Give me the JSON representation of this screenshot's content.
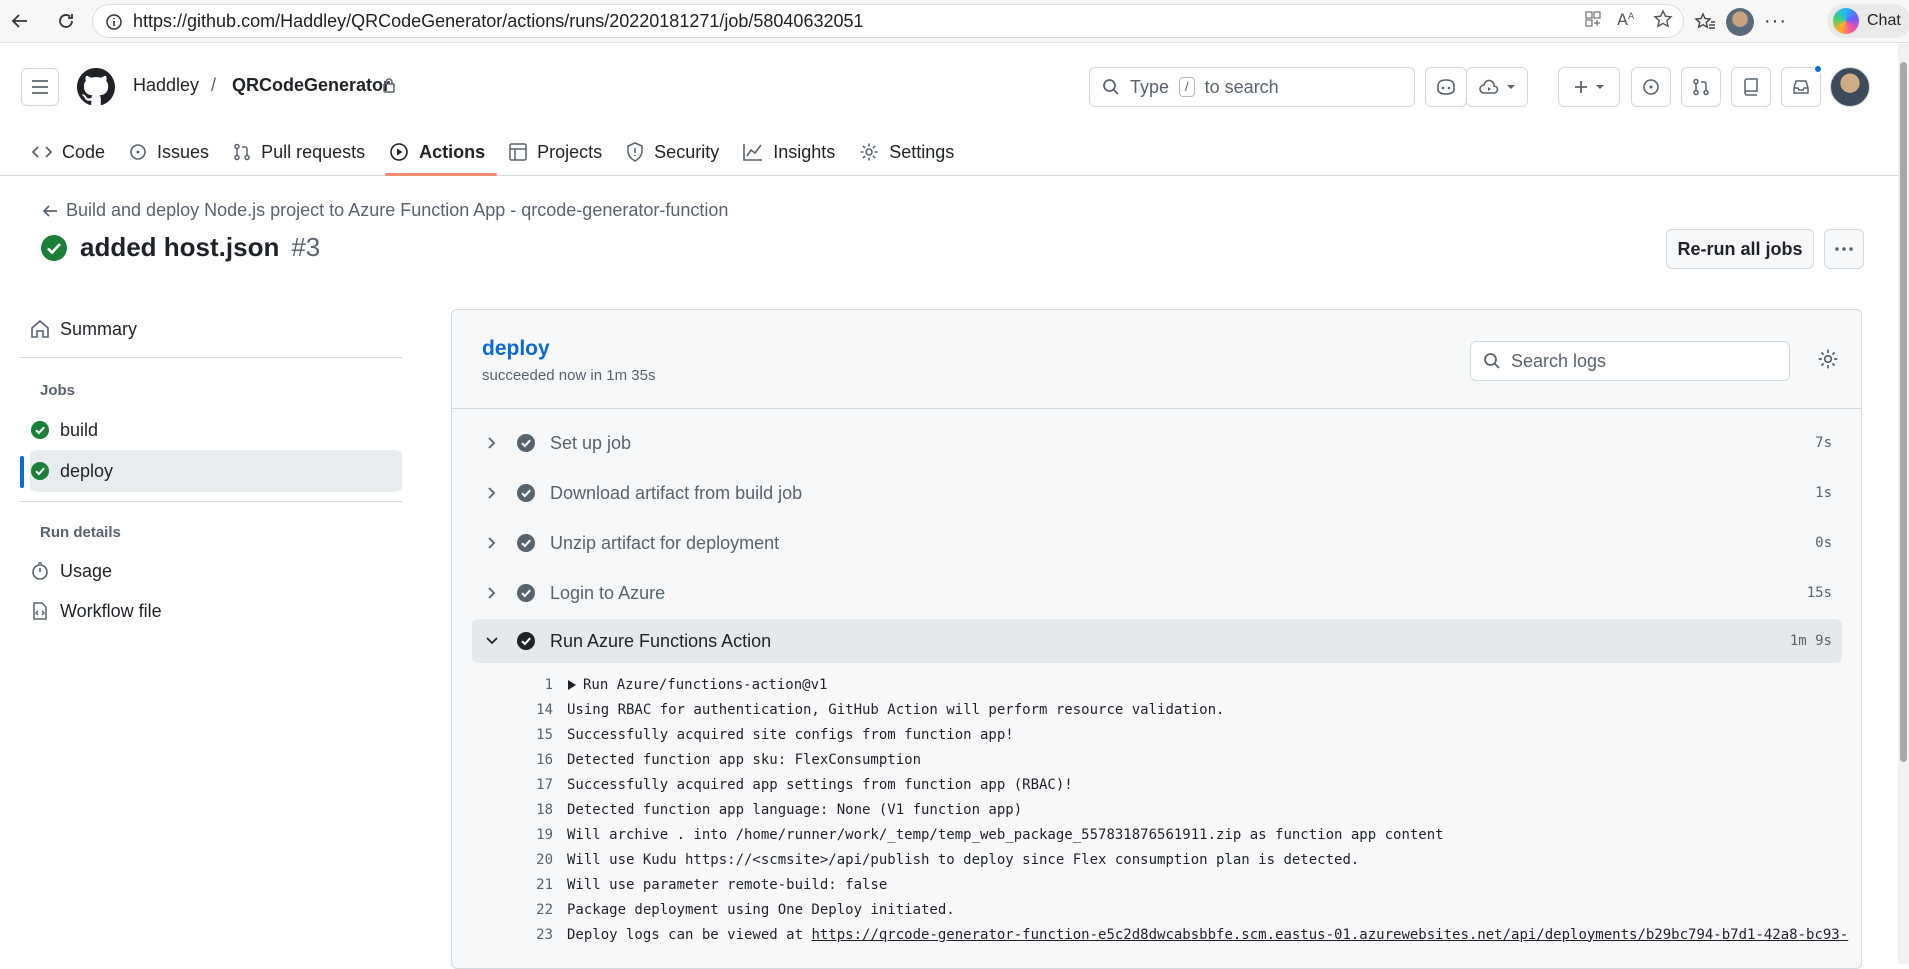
{
  "browser": {
    "url": "https://github.com/Haddley/QRCodeGenerator/actions/runs/20220181271/job/58040632051",
    "chat_label": "Chat"
  },
  "header": {
    "owner": "Haddley",
    "separator": "/",
    "repo": "QRCodeGenerator",
    "search_prefix": "Type",
    "search_key": "/",
    "search_suffix": "to search"
  },
  "tabs": [
    {
      "label": "Code",
      "icon": "code-icon"
    },
    {
      "label": "Issues",
      "icon": "issue-icon"
    },
    {
      "label": "Pull requests",
      "icon": "pull-request-icon"
    },
    {
      "label": "Actions",
      "icon": "play-icon",
      "active": true
    },
    {
      "label": "Projects",
      "icon": "table-icon"
    },
    {
      "label": "Security",
      "icon": "shield-icon"
    },
    {
      "label": "Insights",
      "icon": "graph-icon"
    },
    {
      "label": "Settings",
      "icon": "gear-icon"
    }
  ],
  "run": {
    "workflow_link": "Build and deploy Node.js project to Azure Function App - qrcode-generator-function",
    "title": "added host.json",
    "number": "#3",
    "rerun_label": "Re-run all jobs"
  },
  "sidebar": {
    "summary": "Summary",
    "jobs_heading": "Jobs",
    "jobs": [
      "build",
      "deploy"
    ],
    "run_details_heading": "Run details",
    "usage": "Usage",
    "workflow_file": "Workflow file"
  },
  "job": {
    "name": "deploy",
    "status": "succeeded now in 1m 35s",
    "search_placeholder": "Search logs",
    "steps": [
      {
        "name": "Set up job",
        "duration": "7s"
      },
      {
        "name": "Download artifact from build job",
        "duration": "1s"
      },
      {
        "name": "Unzip artifact for deployment",
        "duration": "0s"
      },
      {
        "name": "Login to Azure",
        "duration": "15s"
      },
      {
        "name": "Run Azure Functions Action",
        "duration": "1m 9s"
      }
    ],
    "log": [
      {
        "n": "1",
        "text": "Run Azure/functions-action@v1"
      },
      {
        "n": "14",
        "text": "Using RBAC for authentication, GitHub Action will perform resource validation."
      },
      {
        "n": "15",
        "text": "Successfully acquired site configs from function app!"
      },
      {
        "n": "16",
        "text": "Detected function app sku: FlexConsumption"
      },
      {
        "n": "17",
        "text": "Successfully acquired app settings from function app (RBAC)!"
      },
      {
        "n": "18",
        "text": "Detected function app language: None (V1 function app)"
      },
      {
        "n": "19",
        "text": "Will archive . into /home/runner/work/_temp/temp_web_package_557831876561911.zip as function app content"
      },
      {
        "n": "20",
        "text": "Will use Kudu https://<scmsite>/api/publish to deploy since Flex consumption plan is detected."
      },
      {
        "n": "21",
        "text": "Will use parameter remote-build: false"
      },
      {
        "n": "22",
        "text": "Package deployment using One Deploy initiated."
      },
      {
        "n": "23",
        "text": "Deploy logs can be viewed at ",
        "link": "https://qrcode-generator-function-e5c2d8dwcabsbbfe.scm.eastus-01.azurewebsites.net/api/deployments/b29bc794-b7d1-42a8-bc93-"
      }
    ]
  },
  "colors": {
    "success": "#1a7f37",
    "link": "#0969da",
    "tab_underline": "#fd8c73"
  }
}
